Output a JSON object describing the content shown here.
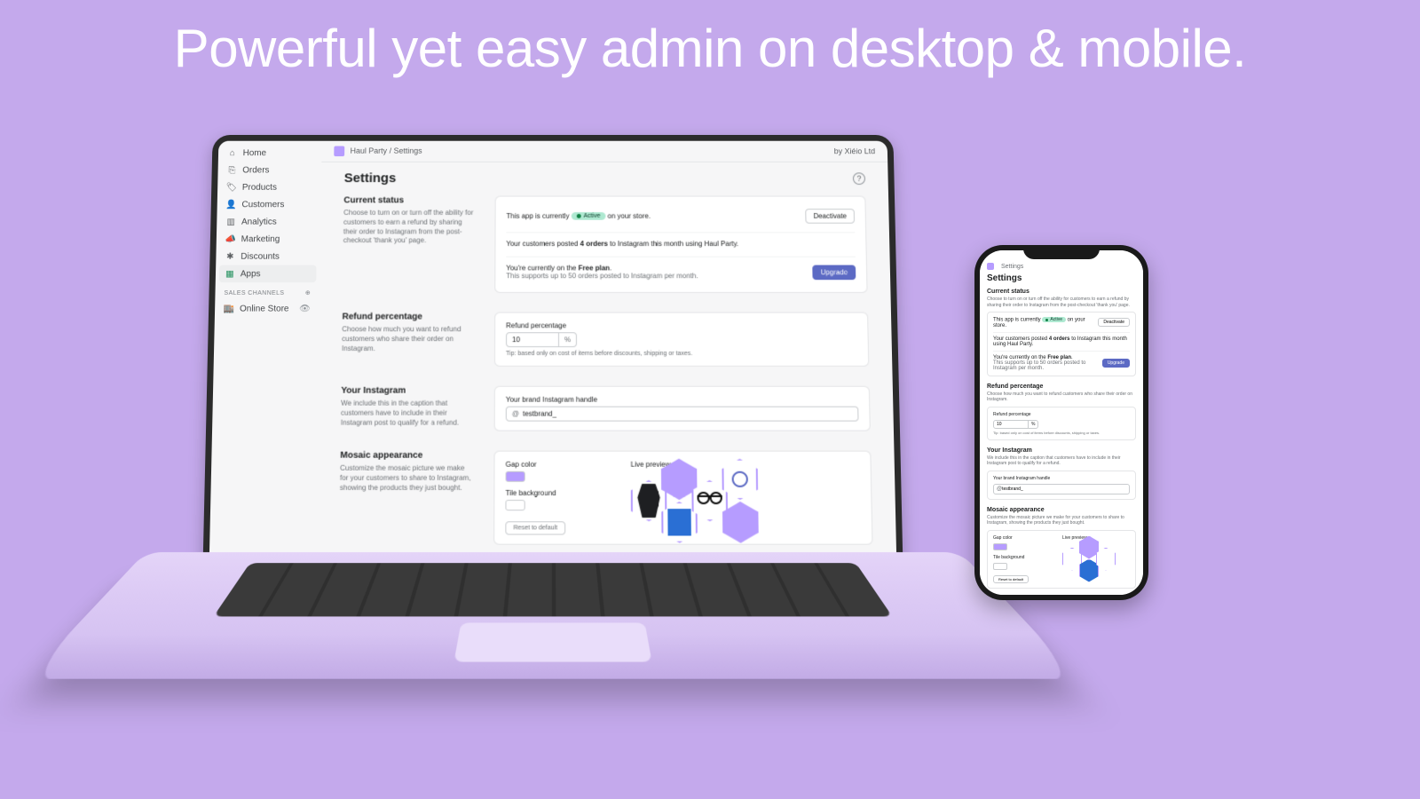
{
  "banner": "Powerful yet easy admin on desktop & mobile.",
  "vendor": "by Xiéio Ltd",
  "breadcrumb": {
    "app": "Haul Party",
    "page": "Settings"
  },
  "page_title": "Settings",
  "sidebar": {
    "items": [
      {
        "label": "Home"
      },
      {
        "label": "Orders"
      },
      {
        "label": "Products"
      },
      {
        "label": "Customers"
      },
      {
        "label": "Analytics"
      },
      {
        "label": "Marketing"
      },
      {
        "label": "Discounts"
      },
      {
        "label": "Apps"
      }
    ],
    "channels_heading": "SALES CHANNELS",
    "channels": [
      {
        "label": "Online Store"
      }
    ]
  },
  "status": {
    "heading": "Current status",
    "desc": "Choose to turn on or turn off the ability for customers to earn a refund by sharing their order to Instagram from the post-checkout 'thank you' page.",
    "line_prefix": "This app is currently",
    "badge": "Active",
    "line_suffix": "on your store.",
    "deactivate": "Deactivate",
    "usage_prefix": "Your customers posted",
    "usage_bold": "4 orders",
    "usage_suffix": "to Instagram this month using Haul Party.",
    "plan_prefix": "You're currently on the",
    "plan_bold": "Free plan",
    "plan_end": ".",
    "plan_limit": "This supports up to 50 orders posted to Instagram per month.",
    "upgrade": "Upgrade"
  },
  "refund": {
    "heading": "Refund percentage",
    "desc": "Choose how much you want to refund customers who share their order on Instagram.",
    "label": "Refund percentage",
    "value": "10",
    "suffix": "%",
    "tip": "Tip: based only on cost of items before discounts, shipping or taxes."
  },
  "instagram": {
    "heading": "Your Instagram",
    "desc": "We include this in the caption that customers have to include in their Instagram post to qualify for a refund.",
    "label": "Your brand Instagram handle",
    "at": "@",
    "value": "testbrand_"
  },
  "mosaic": {
    "heading": "Mosaic appearance",
    "desc": "Customize the mosaic picture we make for your customers to share to Instagram, showing the products they just bought.",
    "gap_label": "Gap color",
    "tile_label": "Tile background",
    "preview_label": "Live preview",
    "reset": "Reset to default"
  }
}
